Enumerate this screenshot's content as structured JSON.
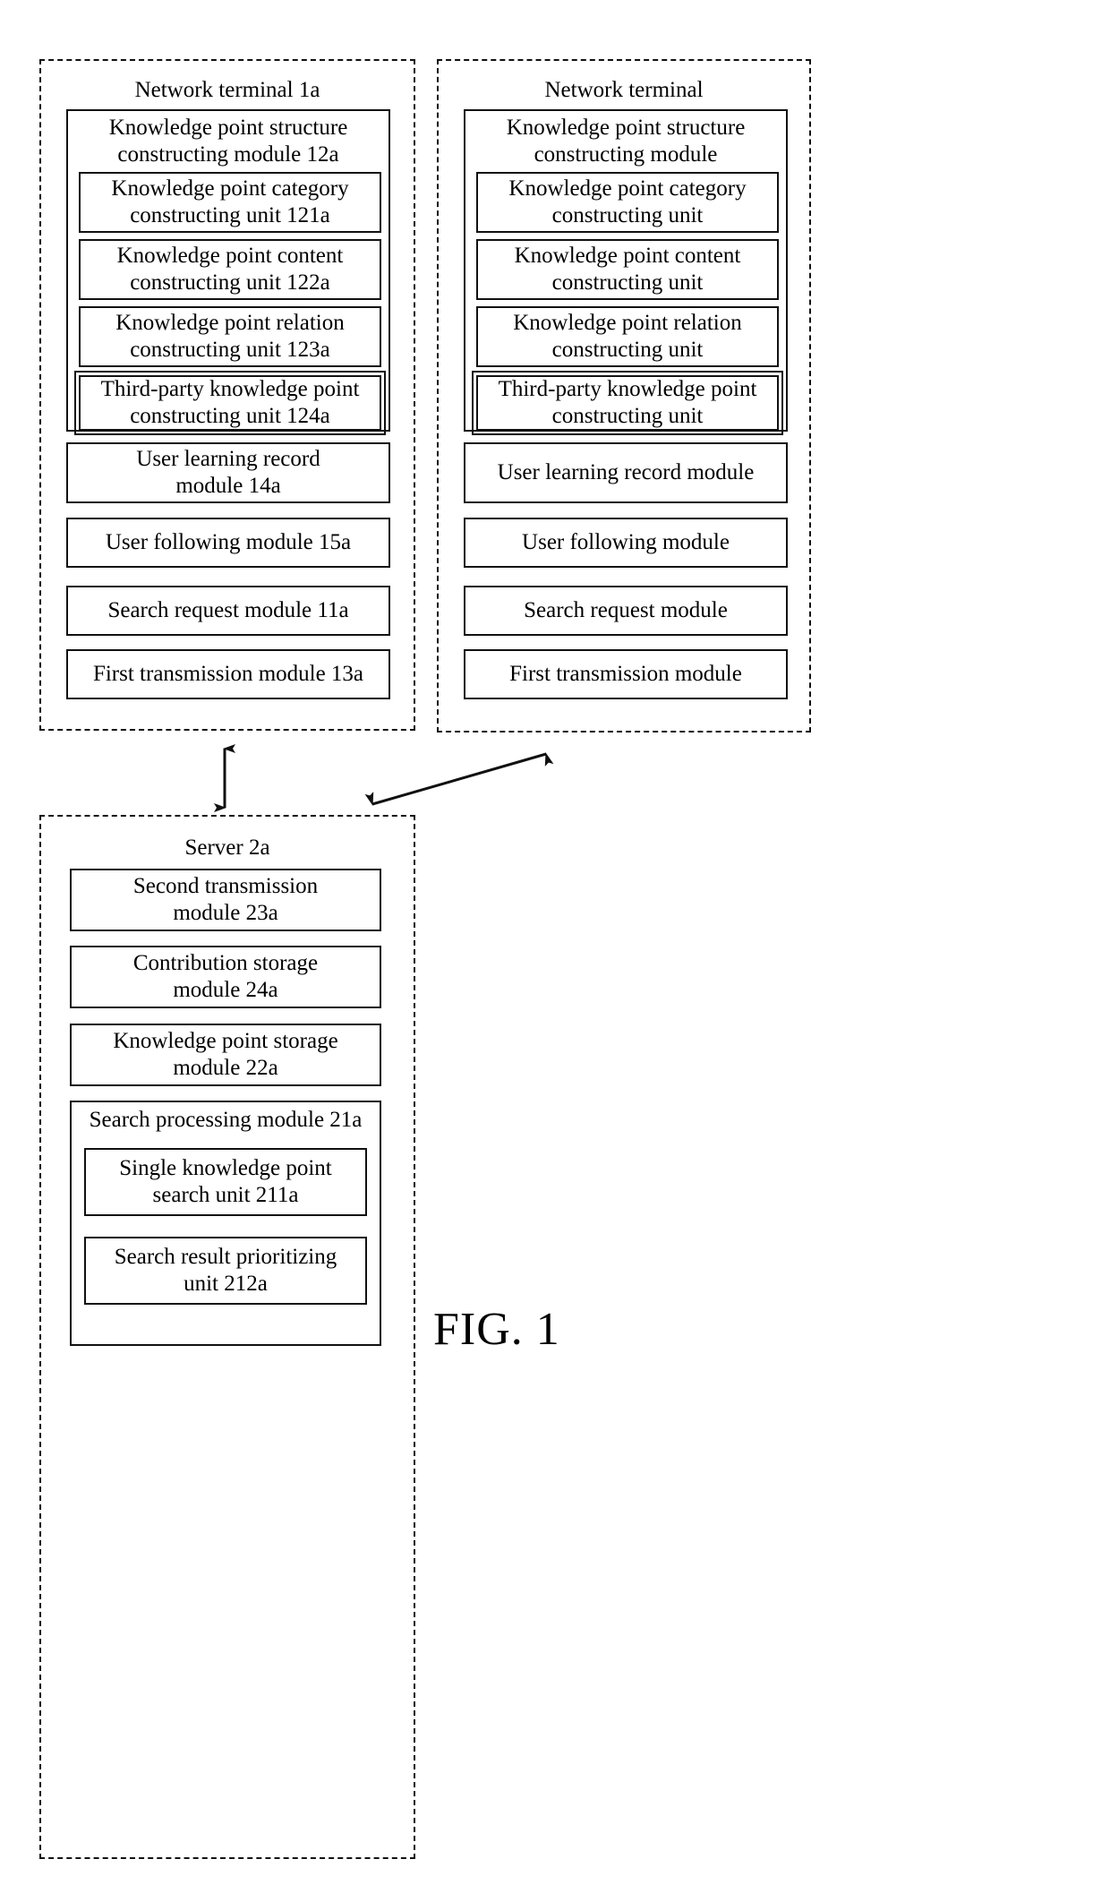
{
  "figure": {
    "caption": "FIG. 1"
  },
  "terminal_left": {
    "title": "Network terminal 1a",
    "structure_module": {
      "title_line1": "Knowledge point structure",
      "title_line2": "constructing module 12a",
      "units": [
        {
          "line1": "Knowledge point category",
          "line2": "constructing unit 121a",
          "double": false
        },
        {
          "line1": "Knowledge point content",
          "line2": "constructing unit 122a",
          "double": false
        },
        {
          "line1": "Knowledge point relation",
          "line2": "constructing unit 123a",
          "double": false
        },
        {
          "line1": "Third-party knowledge point",
          "line2": "constructing unit 124a",
          "double": true
        }
      ]
    },
    "modules": [
      {
        "line1": "User learning record",
        "line2": "module 14a"
      },
      {
        "line1": "User following module 15a",
        "line2": ""
      },
      {
        "line1": "Search request module 11a",
        "line2": ""
      },
      {
        "line1": "First transmission module 13a",
        "line2": ""
      }
    ]
  },
  "terminal_right": {
    "title": "Network terminal",
    "structure_module": {
      "title_line1": "Knowledge point structure",
      "title_line2": "constructing module",
      "units": [
        {
          "line1": "Knowledge point category",
          "line2": "constructing unit",
          "double": false
        },
        {
          "line1": "Knowledge point content",
          "line2": "constructing unit",
          "double": false
        },
        {
          "line1": "Knowledge point relation",
          "line2": "constructing unit",
          "double": false
        },
        {
          "line1": "Third-party knowledge point",
          "line2": "constructing unit",
          "double": true
        }
      ]
    },
    "modules": [
      {
        "line1": "User learning record module",
        "line2": ""
      },
      {
        "line1": "User following module",
        "line2": ""
      },
      {
        "line1": "Search request module",
        "line2": ""
      },
      {
        "line1": "First transmission module",
        "line2": ""
      }
    ]
  },
  "server": {
    "title": "Server 2a",
    "modules": [
      {
        "line1": "Second transmission",
        "line2": "module 23a"
      },
      {
        "line1": "Contribution storage",
        "line2": "module 24a"
      },
      {
        "line1": "Knowledge point storage",
        "line2": "module 22a"
      }
    ],
    "search_module": {
      "title": "Search processing module 21a",
      "units": [
        {
          "line1": "Single knowledge point",
          "line2": "search unit 211a"
        },
        {
          "line1": "Search result prioritizing",
          "line2": "unit 212a"
        }
      ]
    }
  },
  "connectors": {
    "vertical_arrow": "double-headed-vertical-arrow",
    "diagonal_arrow": "double-headed-diagonal-arrow"
  }
}
